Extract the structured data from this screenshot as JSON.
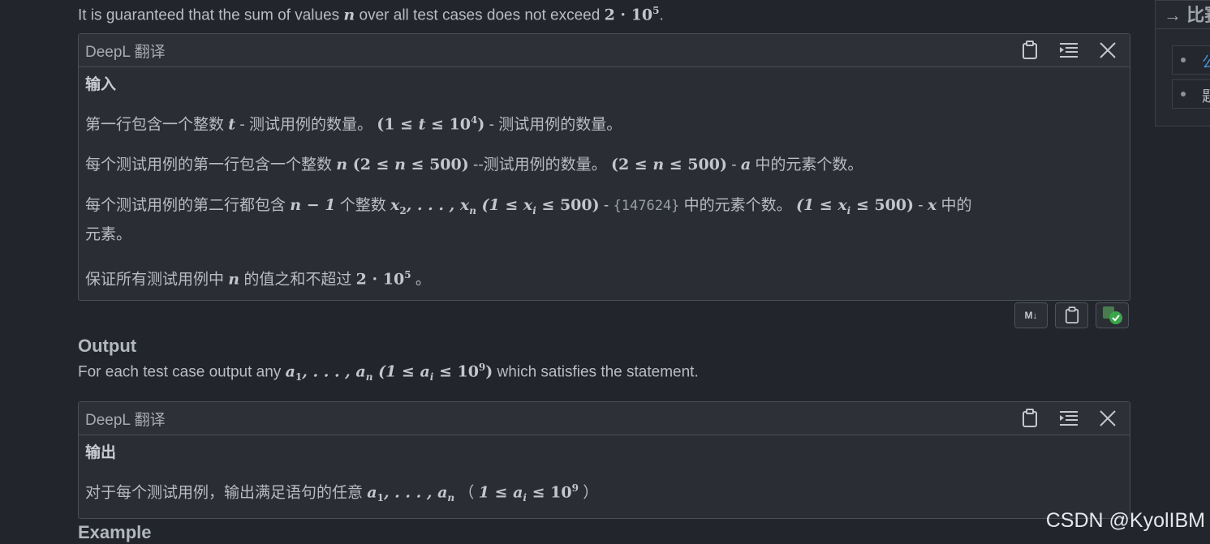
{
  "intro": {
    "text_a": "It is guaranteed that the sum of values ",
    "var_n": "n",
    "text_b": " over all test cases does not exceed ",
    "bound": "2 · 10",
    "bound_exp": "5",
    "text_c": "."
  },
  "deepl_header": "DeepL 翻译",
  "input_box": {
    "heading": "输入",
    "p1_a": "第一行包含一个整数 ",
    "p1_t": "t",
    "p1_b": " - 测试用例的数量。 ",
    "p1_m1": "(1 ≤ ",
    "p1_m2": " ≤ 10",
    "p1_m3": ")",
    "p1_exp": "4",
    "p1_c": " - 测试用例的数量。",
    "p2_a": "每个测试用例的第一行包含一个整数 ",
    "p2_n": "n",
    "p2_m1": " (2 ≤ ",
    "p2_m2": " ≤ 500)",
    "p2_b": " --测试用例的数量。 ",
    "p2_m3": "(2 ≤ ",
    "p2_m4": " ≤ 500)",
    "p2_c": " - ",
    "p2_a_var": "a",
    "p2_d": " 中的元素个数。",
    "p3_a": "每个测试用例的第二行都包含 ",
    "p3_nm1": "n − 1",
    "p3_b": " 个整数 ",
    "p3_xs": "x",
    "p3_xs_sub": "2",
    "p3_dots": ", . . . , x",
    "p3_xn_sub": "n",
    "p3_m1": " (1 ≤ x",
    "p3_xi_sub": "i",
    "p3_m2": " ≤ 500)",
    "p3_c": " - ",
    "p3_code": "{147624}",
    "p3_d": " 中的元素个数。 ",
    "p3_m3": "(1 ≤ x",
    "p3_m4": " ≤ 500)",
    "p3_e": " - ",
    "p3_x": "x",
    "p3_f": " 中的",
    "p3_g": "元素。",
    "p4_a": "保证所有测试用例中 ",
    "p4_n": "n",
    "p4_b": " 的值之和不超过 ",
    "p4_m": "2 · 10",
    "p4_exp": "5",
    "p4_c": " 。"
  },
  "toolbar": {
    "markdown_label": "M↓"
  },
  "output_section": {
    "heading": "Output",
    "text_a": "For each test case output any ",
    "math_a": "a",
    "sub_1": "1",
    "math_dots": ", . . . , a",
    "sub_n": "n",
    "math_b": " (1 ≤ a",
    "sub_i": "i",
    "math_c": " ≤ 10",
    "exp_9": "9",
    "math_d": ")",
    "text_b": " which satisfies the statement."
  },
  "output_box": {
    "heading": "输出",
    "p_a": "对于每个测试用例，输出满足语句的任意 ",
    "math_a": "a",
    "sub_1": "1",
    "math_dots": ", . . . , a",
    "sub_n": "n",
    "p_b": " （ ",
    "math_b": "1 ≤ a",
    "sub_i": "i",
    "math_c": " ≤ 10",
    "exp_9": "9",
    "p_c": " ）"
  },
  "example_heading": "Example",
  "watermark": "CSDN @KyolIBM",
  "side": {
    "title": "→ 比赛",
    "item1": "公",
    "item2": "题"
  },
  "colors": {
    "background": "#22252b",
    "link": "#4a8fd8",
    "check": "#3aa64a"
  }
}
